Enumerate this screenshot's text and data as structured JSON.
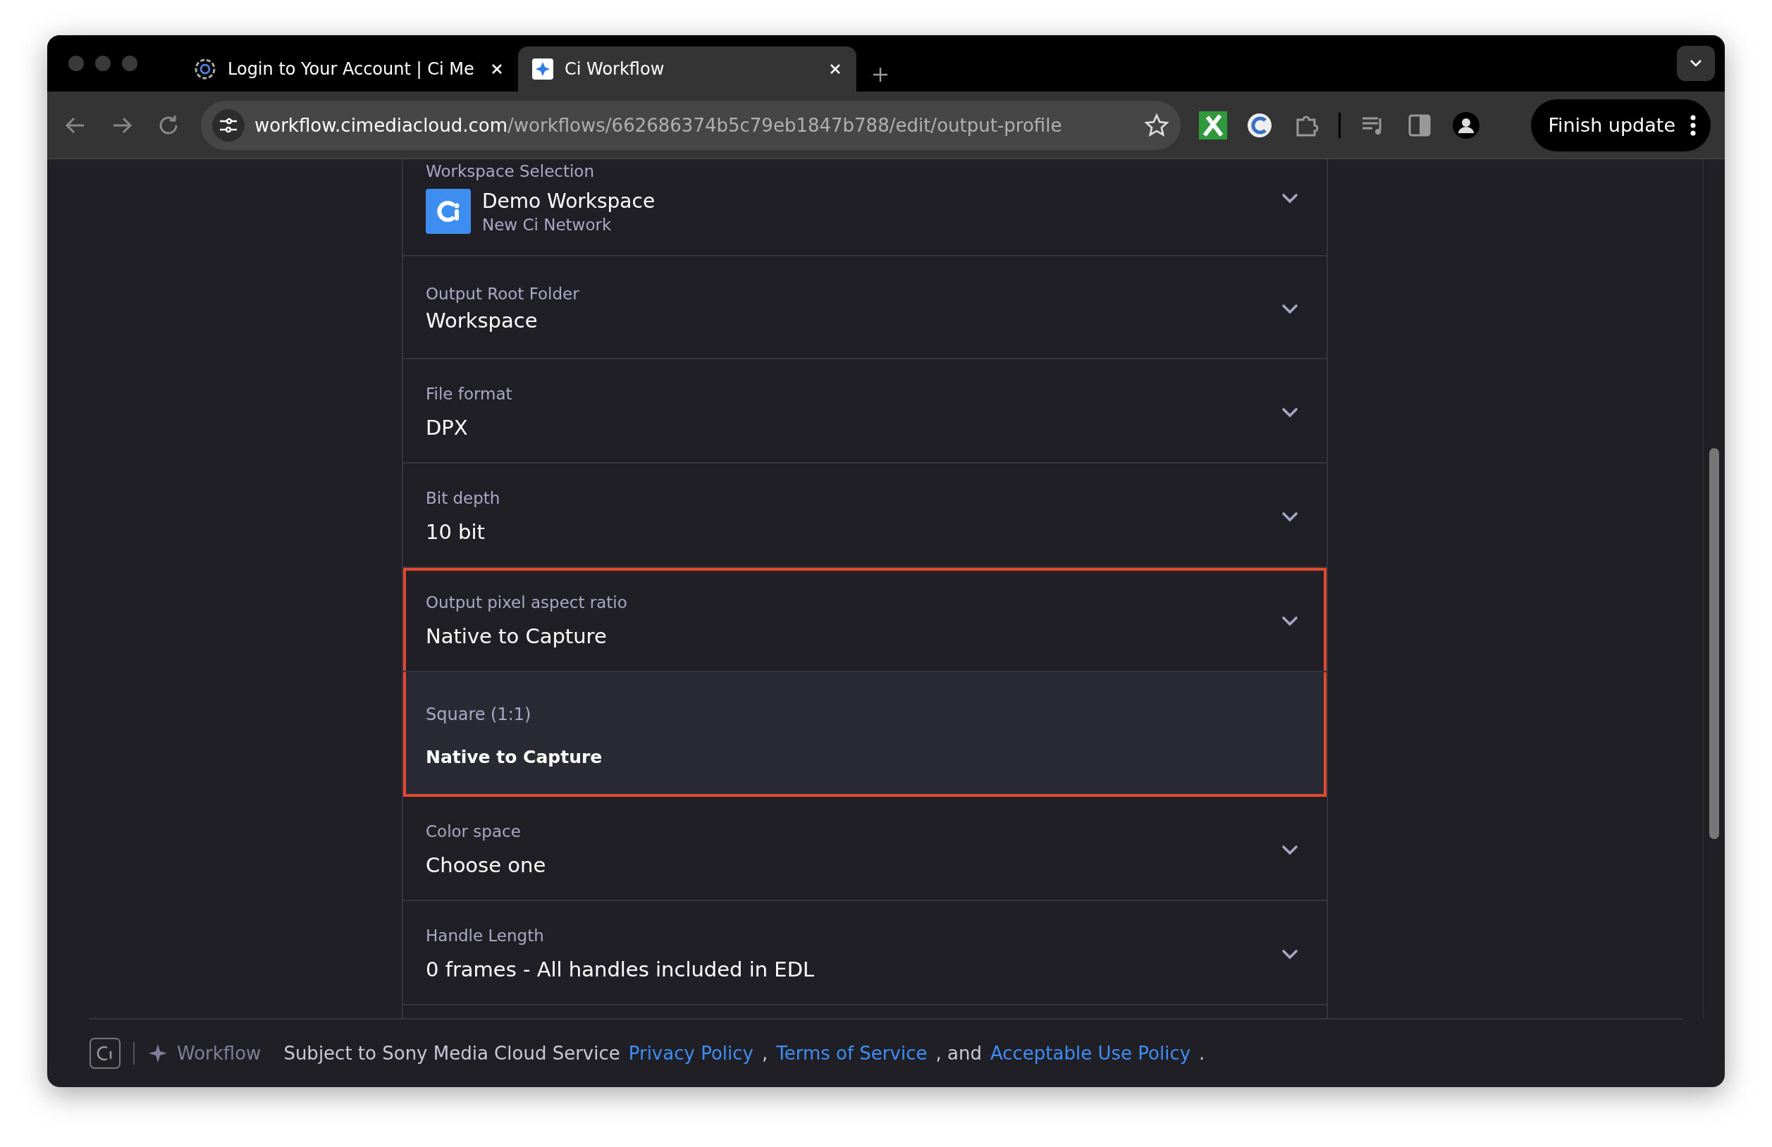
{
  "browser": {
    "tabs": [
      {
        "title": "Login to Your Account | Ci Me",
        "selected": false
      },
      {
        "title": "Ci Workflow",
        "selected": true
      }
    ],
    "address": {
      "host": "workflow.cimediacloud.com",
      "path": "/workflows/662686374b5c79eb1847b788/edit/output-profile"
    },
    "update_button": "Finish update"
  },
  "form": {
    "fields": [
      {
        "kind": "workspace",
        "label": "Workspace Selection",
        "value": "Demo Workspace",
        "subtitle": "New Ci Network",
        "highlighted": false
      },
      {
        "kind": "select",
        "label": "Output Root Folder",
        "value": "Workspace",
        "highlighted": false
      },
      {
        "kind": "select",
        "label": "File format",
        "value": "DPX",
        "highlighted": false
      },
      {
        "kind": "select",
        "label": "Bit depth",
        "value": "10 bit",
        "highlighted": false
      },
      {
        "kind": "select",
        "label": "Output pixel aspect ratio",
        "value": "Native to Capture",
        "highlighted": true,
        "options": [
          {
            "label": "Square (1:1)",
            "selected": false
          },
          {
            "label": "Native to Capture",
            "selected": true
          }
        ]
      },
      {
        "kind": "select",
        "label": "Color space",
        "value": "Choose one",
        "highlighted": false
      },
      {
        "kind": "select",
        "label": "Handle Length",
        "value": "0 frames - All handles included in EDL",
        "highlighted": false
      }
    ]
  },
  "footer": {
    "app_name": "Workflow",
    "notice": "Subject to Sony Media Cloud Service",
    "links": [
      "Privacy Policy",
      "Terms of Service",
      "Acceptable Use Policy"
    ],
    "separators": [
      ",",
      ", and",
      "."
    ]
  }
}
